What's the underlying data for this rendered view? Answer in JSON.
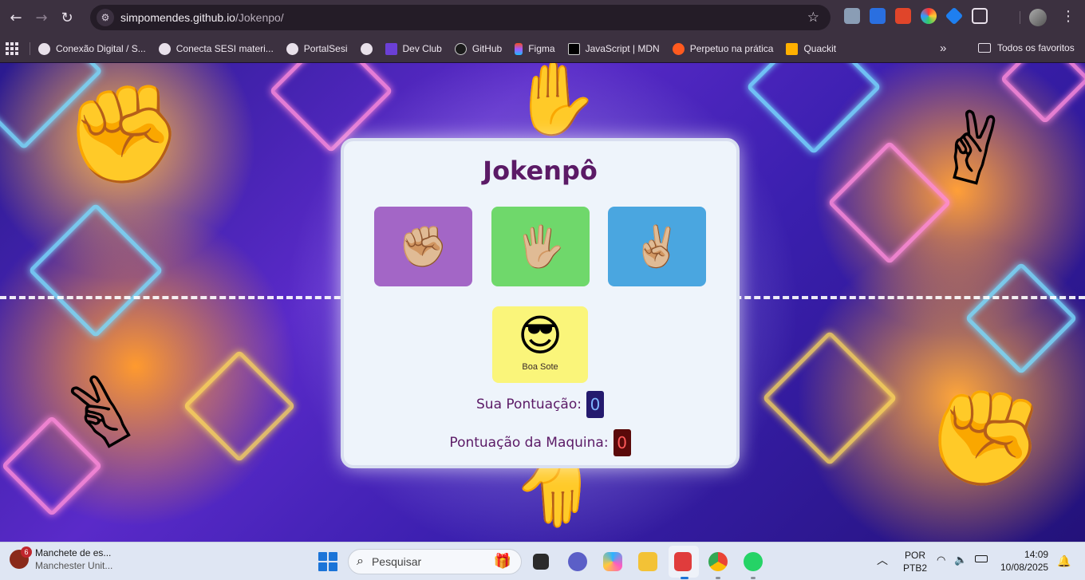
{
  "browser": {
    "url_host": "simpomendes.github.io",
    "url_path": "/Jokenpo/",
    "bookmarks": [
      {
        "label": "Conexão Digital / S...",
        "color": "#e8e0ea"
      },
      {
        "label": "Conecta SESI materi...",
        "color": "#e8e0ea"
      },
      {
        "label": "PortalSesi",
        "color": "#e8e0ea"
      },
      {
        "label": "",
        "color": "#e8e0ea"
      },
      {
        "label": "Dev Club",
        "color": "#6b3fd6"
      },
      {
        "label": "GitHub",
        "color": "#1b1b1b"
      },
      {
        "label": "Figma",
        "color": "#f24e1e"
      },
      {
        "label": "JavaScript | MDN",
        "color": "#000000"
      },
      {
        "label": "Perpetuo na prática",
        "color": "#ff5a1f"
      },
      {
        "label": "Quackit",
        "color": "#ffb000"
      }
    ],
    "more_bookmarks_icon": "chevron-double-right-icon",
    "all_bookmarks_label": "Todos os favoritos"
  },
  "game": {
    "title": "Jokenpô",
    "choices": [
      {
        "id": "rock",
        "emoji": "✊🏼"
      },
      {
        "id": "paper",
        "emoji": "🖐🏼"
      },
      {
        "id": "scissors",
        "emoji": "✌🏼"
      }
    ],
    "result_emoji": "😎",
    "result_caption": "Boa Sote",
    "user_score_label": "Sua Pontuação:",
    "user_score": "0",
    "machine_score_label": "Pontuação da Maquina:",
    "machine_score": "0",
    "colors": {
      "title": "#5b1a66",
      "rock": "#a366c6",
      "paper": "#6fd86b",
      "scissors": "#4aa6e0",
      "result": "#faf57a"
    }
  },
  "taskbar": {
    "news_badge": "6",
    "news_title": "Manchete de es...",
    "news_subtitle": "Manchester Unit...",
    "search_placeholder": "Pesquisar",
    "language": "POR",
    "keyboard": "PTB2",
    "time": "14:09",
    "date": "10/08/2025"
  }
}
